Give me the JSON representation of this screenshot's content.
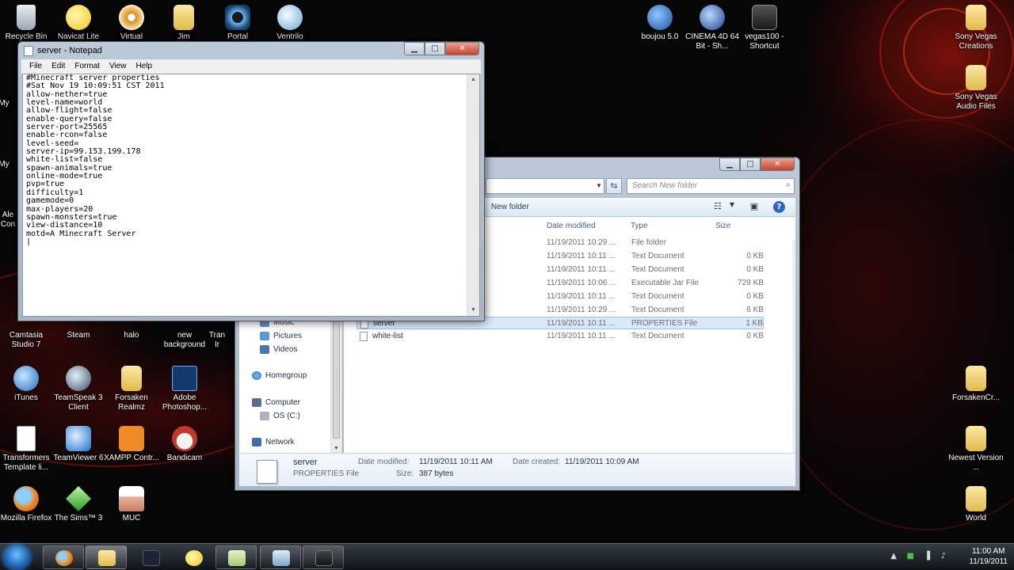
{
  "desktop": {
    "icons": [
      {
        "label": "Recycle Bin"
      },
      {
        "label": "Navicat Lite"
      },
      {
        "label": "Virtual CloneDrive"
      },
      {
        "label": "Jim"
      },
      {
        "label": "Portal"
      },
      {
        "label": "Ventrilo"
      },
      {
        "label": "boujou 5.0"
      },
      {
        "label": "CINEMA 4D 64 Bit - Sh..."
      },
      {
        "label": "vegas100 - Shortcut"
      },
      {
        "label": "Sony Vegas Creations"
      },
      {
        "label": "Sony Vegas Audio Files"
      },
      {
        "label": "Camtasia Studio 7"
      },
      {
        "label": "Steam"
      },
      {
        "label": "halo"
      },
      {
        "label": "new background"
      },
      {
        "label": "Tran"
      },
      {
        "label": "iTunes"
      },
      {
        "label": "TeamSpeak 3 Client"
      },
      {
        "label": "Forsaken Realmz"
      },
      {
        "label": "Adobe Photoshop..."
      },
      {
        "label": "ForsakenCr..."
      },
      {
        "label": "Transformers Template li..."
      },
      {
        "label": "TeamViewer 6"
      },
      {
        "label": "XAMPP Contr..."
      },
      {
        "label": "Bandicam"
      },
      {
        "label": "Newest Version ..."
      },
      {
        "label": "Mozilla Firefox"
      },
      {
        "label": "The Sims™ 3"
      },
      {
        "label": "MUC"
      },
      {
        "label": "World"
      }
    ],
    "partial_labels": [
      "My",
      "My",
      "Ale",
      "Con",
      "Ir"
    ]
  },
  "notepad": {
    "title": "server - Notepad",
    "menu": [
      "File",
      "Edit",
      "Format",
      "View",
      "Help"
    ],
    "content": "#Minecraft server properties\n#Sat Nov 19 10:09:51 CST 2011\nallow-nether=true\nlevel-name=world\nallow-flight=false\nenable-query=false\nserver-port=25565\nenable-rcon=false\nlevel-seed=\nserver-ip=99.153.199.178\nwhite-list=false\nspawn-animals=true\nonline-mode=true\npvp=true\ndifficulty=1\ngamemode=0\nmax-players=20\nspawn-monsters=true\nview-distance=10\nmotd=A Minecraft Server\n|"
  },
  "explorer": {
    "search_placeholder": "Search New folder",
    "toolbar": {
      "new_folder": "New folder"
    },
    "nav": [
      "Music",
      "Pictures",
      "Videos",
      "Homegroup",
      "Computer",
      "OS (C:)",
      "Network"
    ],
    "columns": {
      "date": "Date modified",
      "type": "Type",
      "size": "Size"
    },
    "files": [
      {
        "name": "",
        "date": "11/19/2011 10:29 ...",
        "type": "File folder",
        "size": ""
      },
      {
        "name": "",
        "date": "11/19/2011 10:11 ...",
        "type": "Text Document",
        "size": "0 KB"
      },
      {
        "name": "",
        "date": "11/19/2011 10:11 ...",
        "type": "Text Document",
        "size": "0 KB"
      },
      {
        "name": "",
        "date": "11/19/2011 10:06 ...",
        "type": "Executable Jar File",
        "size": "729 KB"
      },
      {
        "name": "",
        "date": "11/19/2011 10:11 ...",
        "type": "Text Document",
        "size": "0 KB"
      },
      {
        "name": "",
        "date": "11/19/2011 10:29 ...",
        "type": "Text Document",
        "size": "6 KB"
      },
      {
        "name": "server",
        "date": "11/19/2011 10:11 ...",
        "type": "PROPERTIES File",
        "size": "1 KB"
      },
      {
        "name": "white-list",
        "date": "11/19/2011 10:11 ...",
        "type": "Text Document",
        "size": "0 KB"
      }
    ],
    "details": {
      "name": "server",
      "type": "PROPERTIES File",
      "modified_label": "Date modified:",
      "modified": "11/19/2011 10:11 AM",
      "created_label": "Date created:",
      "created": "11/19/2011 10:09 AM",
      "size_label": "Size:",
      "size": "387 bytes"
    }
  },
  "taskbar": {
    "time": "11:00 AM",
    "date": "11/19/2011"
  }
}
